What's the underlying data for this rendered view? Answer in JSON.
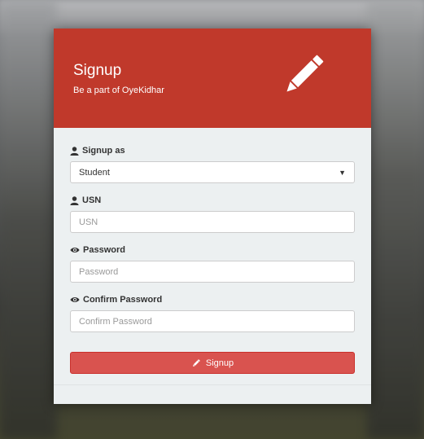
{
  "header": {
    "title": "Signup",
    "subtitle": "Be a part of OyeKidhar",
    "icon": "pencil-icon"
  },
  "fields": {
    "signup_as": {
      "label": "Signup as",
      "icon": "user-icon",
      "selected": "Student"
    },
    "usn": {
      "label": "USN",
      "icon": "user-icon",
      "placeholder": "USN"
    },
    "password": {
      "label": "Password",
      "icon": "eye-icon",
      "placeholder": "Password"
    },
    "confirm_password": {
      "label": "Confirm Password",
      "icon": "eye-icon",
      "placeholder": "Confirm Password"
    }
  },
  "submit": {
    "label": "Signup",
    "icon": "pencil-icon"
  },
  "colors": {
    "header": "#c0392b",
    "button": "#d9534f",
    "card": "#ecf0f1"
  }
}
